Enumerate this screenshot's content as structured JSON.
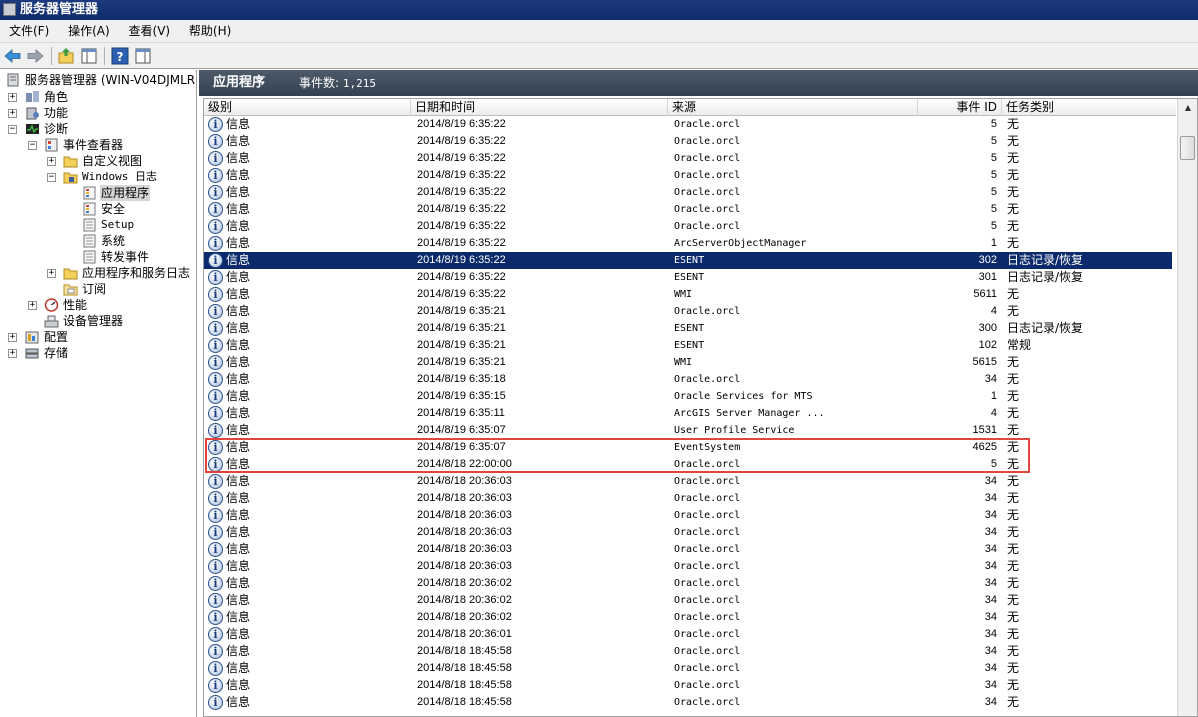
{
  "window": {
    "title": "服务器管理器"
  },
  "menu": [
    {
      "label": "文件(F)"
    },
    {
      "label": "操作(A)"
    },
    {
      "label": "查看(V)"
    },
    {
      "label": "帮助(H)"
    }
  ],
  "toolbar": {
    "icons": [
      "back-arrow-icon",
      "forward-arrow-icon",
      "up-folder-icon",
      "show-hide-tree-icon",
      "help-icon",
      "action-pane-icon"
    ]
  },
  "tree": {
    "root": "服务器管理器 (WIN-V04DJMLR70",
    "roles": "角色",
    "features": "功能",
    "diagnostics": "诊断",
    "event_viewer": "事件查看器",
    "custom_views": "自定义视图",
    "windows_logs": "Windows 日志",
    "application": "应用程序",
    "security": "安全",
    "setup": "Setup",
    "system": "系统",
    "forwarded": "转发事件",
    "app_services_logs": "应用程序和服务日志",
    "subscriptions": "订阅",
    "performance": "性能",
    "device_manager": "设备管理器",
    "configuration": "配置",
    "storage": "存储"
  },
  "panel": {
    "title": "应用程序",
    "count_label": "事件数: ",
    "count_value": "1,215"
  },
  "columns": {
    "level": "级别",
    "date": "日期和时间",
    "source": "来源",
    "event_id": "事件 ID",
    "task": "任务类别"
  },
  "info_glyph": "i",
  "colors": {
    "selected_row": "#0b2a6b",
    "highlight_border": "#e0463b",
    "header_band": "#3f4c5c"
  },
  "events": [
    {
      "level": "信息",
      "date": "2014/8/19 6:35:22",
      "source": "Oracle.orcl",
      "id": "5",
      "task": "无"
    },
    {
      "level": "信息",
      "date": "2014/8/19 6:35:22",
      "source": "Oracle.orcl",
      "id": "5",
      "task": "无"
    },
    {
      "level": "信息",
      "date": "2014/8/19 6:35:22",
      "source": "Oracle.orcl",
      "id": "5",
      "task": "无"
    },
    {
      "level": "信息",
      "date": "2014/8/19 6:35:22",
      "source": "Oracle.orcl",
      "id": "5",
      "task": "无"
    },
    {
      "level": "信息",
      "date": "2014/8/19 6:35:22",
      "source": "Oracle.orcl",
      "id": "5",
      "task": "无"
    },
    {
      "level": "信息",
      "date": "2014/8/19 6:35:22",
      "source": "Oracle.orcl",
      "id": "5",
      "task": "无"
    },
    {
      "level": "信息",
      "date": "2014/8/19 6:35:22",
      "source": "Oracle.orcl",
      "id": "5",
      "task": "无"
    },
    {
      "level": "信息",
      "date": "2014/8/19 6:35:22",
      "source": "ArcServerObjectManager",
      "id": "1",
      "task": "无"
    },
    {
      "level": "信息",
      "date": "2014/8/19 6:35:22",
      "source": "ESENT",
      "id": "302",
      "task": "日志记录/恢复",
      "selected": true
    },
    {
      "level": "信息",
      "date": "2014/8/19 6:35:22",
      "source": "ESENT",
      "id": "301",
      "task": "日志记录/恢复"
    },
    {
      "level": "信息",
      "date": "2014/8/19 6:35:22",
      "source": "WMI",
      "id": "5611",
      "task": "无"
    },
    {
      "level": "信息",
      "date": "2014/8/19 6:35:21",
      "source": "Oracle.orcl",
      "id": "4",
      "task": "无"
    },
    {
      "level": "信息",
      "date": "2014/8/19 6:35:21",
      "source": "ESENT",
      "id": "300",
      "task": "日志记录/恢复"
    },
    {
      "level": "信息",
      "date": "2014/8/19 6:35:21",
      "source": "ESENT",
      "id": "102",
      "task": "常规"
    },
    {
      "level": "信息",
      "date": "2014/8/19 6:35:21",
      "source": "WMI",
      "id": "5615",
      "task": "无"
    },
    {
      "level": "信息",
      "date": "2014/8/19 6:35:18",
      "source": "Oracle.orcl",
      "id": "34",
      "task": "无"
    },
    {
      "level": "信息",
      "date": "2014/8/19 6:35:15",
      "source": "Oracle Services for MTS",
      "id": "1",
      "task": "无"
    },
    {
      "level": "信息",
      "date": "2014/8/19 6:35:11",
      "source": "ArcGIS Server Manager ...",
      "id": "4",
      "task": "无"
    },
    {
      "level": "信息",
      "date": "2014/8/19 6:35:07",
      "source": "User Profile Service",
      "id": "1531",
      "task": "无"
    },
    {
      "level": "信息",
      "date": "2014/8/19 6:35:07",
      "source": "EventSystem",
      "id": "4625",
      "task": "无"
    },
    {
      "level": "信息",
      "date": "2014/8/18 22:00:00",
      "source": "Oracle.orcl",
      "id": "5",
      "task": "无"
    },
    {
      "level": "信息",
      "date": "2014/8/18 20:36:03",
      "source": "Oracle.orcl",
      "id": "34",
      "task": "无"
    },
    {
      "level": "信息",
      "date": "2014/8/18 20:36:03",
      "source": "Oracle.orcl",
      "id": "34",
      "task": "无"
    },
    {
      "level": "信息",
      "date": "2014/8/18 20:36:03",
      "source": "Oracle.orcl",
      "id": "34",
      "task": "无"
    },
    {
      "level": "信息",
      "date": "2014/8/18 20:36:03",
      "source": "Oracle.orcl",
      "id": "34",
      "task": "无"
    },
    {
      "level": "信息",
      "date": "2014/8/18 20:36:03",
      "source": "Oracle.orcl",
      "id": "34",
      "task": "无"
    },
    {
      "level": "信息",
      "date": "2014/8/18 20:36:03",
      "source": "Oracle.orcl",
      "id": "34",
      "task": "无"
    },
    {
      "level": "信息",
      "date": "2014/8/18 20:36:02",
      "source": "Oracle.orcl",
      "id": "34",
      "task": "无"
    },
    {
      "level": "信息",
      "date": "2014/8/18 20:36:02",
      "source": "Oracle.orcl",
      "id": "34",
      "task": "无"
    },
    {
      "level": "信息",
      "date": "2014/8/18 20:36:02",
      "source": "Oracle.orcl",
      "id": "34",
      "task": "无"
    },
    {
      "level": "信息",
      "date": "2014/8/18 20:36:01",
      "source": "Oracle.orcl",
      "id": "34",
      "task": "无"
    },
    {
      "level": "信息",
      "date": "2014/8/18 18:45:58",
      "source": "Oracle.orcl",
      "id": "34",
      "task": "无"
    },
    {
      "level": "信息",
      "date": "2014/8/18 18:45:58",
      "source": "Oracle.orcl",
      "id": "34",
      "task": "无"
    },
    {
      "level": "信息",
      "date": "2014/8/18 18:45:58",
      "source": "Oracle.orcl",
      "id": "34",
      "task": "无"
    },
    {
      "level": "信息",
      "date": "2014/8/18 18:45:58",
      "source": "Oracle.orcl",
      "id": "34",
      "task": "无"
    }
  ]
}
